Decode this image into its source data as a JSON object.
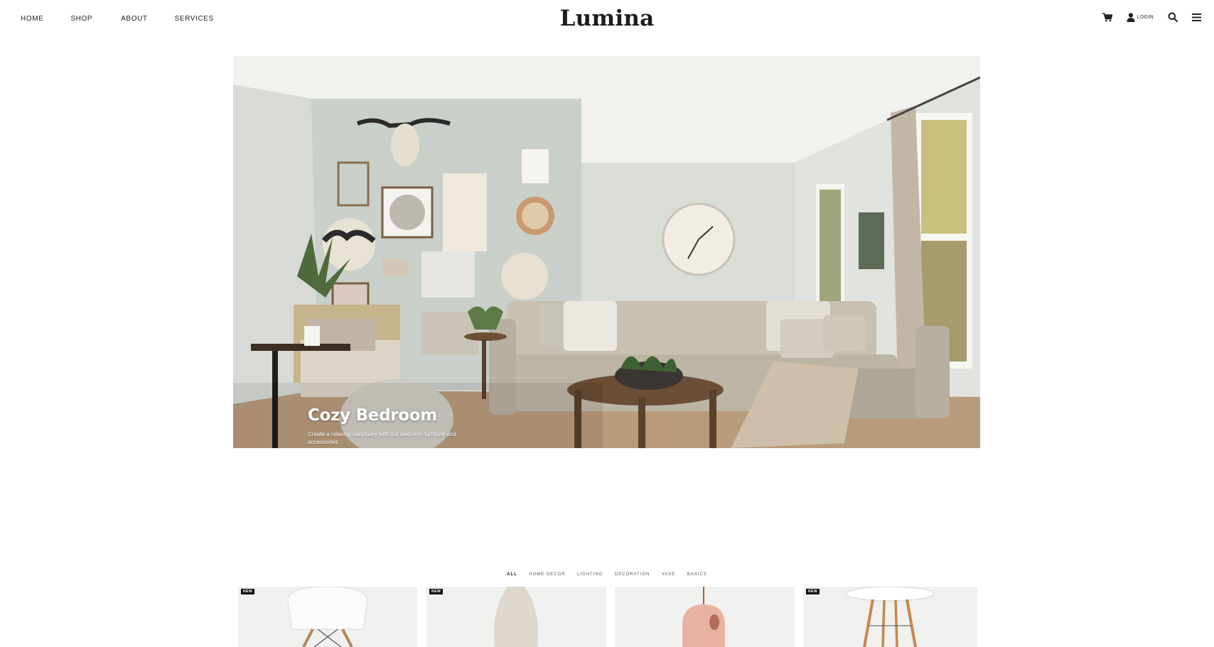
{
  "header": {
    "nav": [
      "HOME",
      "SHOP",
      "ABOUT",
      "SERVICES"
    ],
    "logo": "Lumina",
    "icons": [
      "cart-icon",
      "user-icon",
      "search-icon",
      "menu-icon"
    ],
    "login_label": "LOGIN"
  },
  "hero": {
    "title": "Cozy Bedroom",
    "subtitle": "Create a relaxing sanctuary with our bedroom furniture and accessories."
  },
  "filters": [
    "ALL",
    "HOME DECOR",
    "LIGHTING",
    "DECORATION",
    "VASE",
    "BASICS"
  ],
  "products": [
    {
      "badge": "NEW",
      "kind": "chair"
    },
    {
      "badge": "NEW",
      "kind": "vase"
    },
    {
      "badge": "",
      "kind": "pendant-lamp"
    },
    {
      "badge": "NEW",
      "kind": "side-table"
    }
  ],
  "colors": {
    "text": "#222222",
    "badge_bg": "#111111",
    "card_bg": "#f0f0ef"
  }
}
